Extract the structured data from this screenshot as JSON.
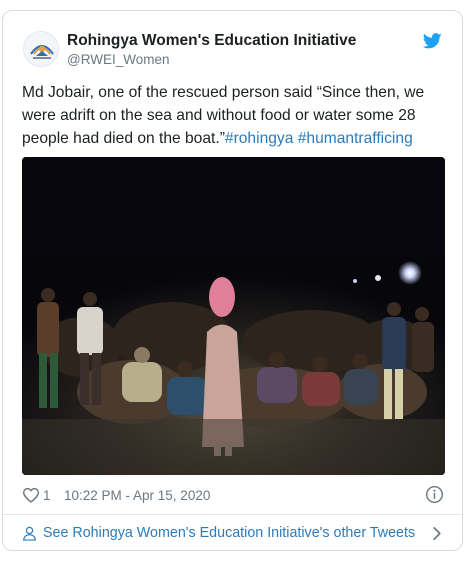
{
  "tweet": {
    "author_name": "Rohingya Women's Education Initiative",
    "author_handle": "@RWEI_Women",
    "body_text": "Md Jobair, one of the rescued person said “Since then, we were adrift on the sea and without food or water some 28 people had died on the boat.”",
    "hashtags": [
      "#rohingya",
      "#humantrafficing"
    ],
    "like_count": "1",
    "timestamp": "10:22 PM - Apr 15, 2020",
    "footer_link": "See Rohingya Women's Education Initiative's other Tweets"
  },
  "icons": {
    "platform": "twitter-bird-icon",
    "like": "heart-icon",
    "info": "info-icon",
    "profile": "person-icon",
    "more": "chevron-right-icon"
  },
  "colors": {
    "link": "#2b7bb9",
    "brand": "#1da1f2",
    "muted": "#697882",
    "text": "#1c2022",
    "border": "#d6dbe0"
  }
}
